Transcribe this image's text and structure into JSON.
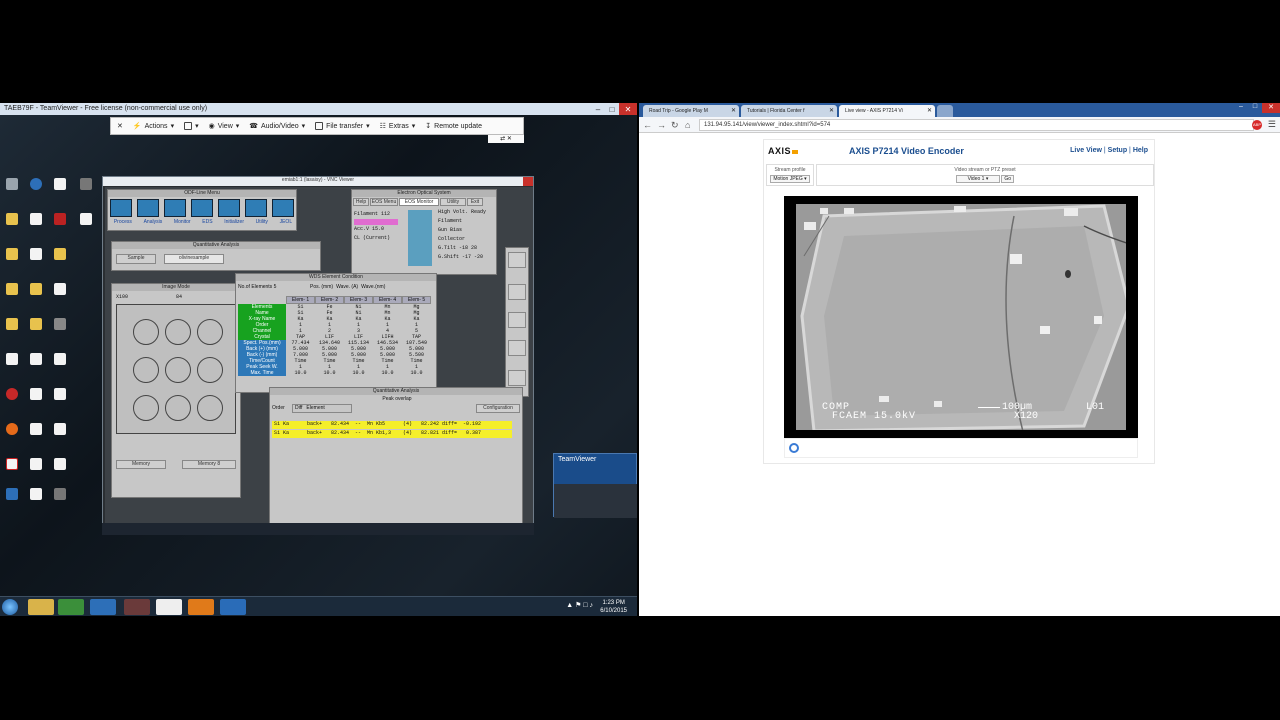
{
  "left": {
    "teamviewer_title": "TAEB79F - TeamViewer - Free license (non-commercial use only)",
    "toolbar": {
      "actions": "Actions",
      "view": "View",
      "audio_video": "Audio/Video",
      "file_transfer": "File transfer",
      "extras": "Extras",
      "remote_update": "Remote update"
    },
    "vnc_title": "emiab1:1 (lasaisy) - VNC Viewer",
    "odf_menu_title": "ODF-Line Menu",
    "odf_buttons": [
      "Process",
      "Analysis",
      "Monitor",
      "EDS",
      "Initializer",
      "Utility",
      "JEOL"
    ],
    "eos_title": "Electron Optical System",
    "eos_menu": [
      "Help",
      "EOS Menu",
      "EOS Monitor",
      "Utility",
      "Exit"
    ],
    "eos_left": [
      "Filament 112",
      "Acc.V 15.0",
      "CL (Current)"
    ],
    "eos_right": [
      "High Volt. Ready",
      "Filament",
      "Gun Bias",
      "Collector",
      "G.Tilt -18 28",
      "G.Shift -17 -20"
    ],
    "quant_title": "Quantitative Analysis",
    "quant_buttons": [
      "Sample",
      "olivinesample"
    ],
    "wds_title": "WDS Element Condition",
    "elements_label": "No.of Elements 5",
    "wds_radio": [
      "Pos. (mm)",
      "Wave. (A)",
      "Wave.(nm)"
    ],
    "wds_cols": [
      "Elem- 1",
      "Elem- 2",
      "Elem- 3",
      "Elem- 4",
      "Elem- 5"
    ],
    "wds_rows": [
      {
        "label": "Elements",
        "vals": [
          "Si",
          "Fe",
          "Ni",
          "Mn",
          "Mg"
        ]
      },
      {
        "label": "Name",
        "vals": [
          "Si",
          "Fe",
          "Ni",
          "Mn",
          "Mg"
        ]
      },
      {
        "label": "X-ray Name",
        "vals": [
          "Ka",
          "Ka",
          "Ka",
          "Ka",
          "Ka"
        ]
      },
      {
        "label": "Order",
        "vals": [
          "1",
          "1",
          "1",
          "1",
          "1"
        ]
      },
      {
        "label": "Channel",
        "vals": [
          "1",
          "2",
          "3",
          "4",
          "5"
        ]
      },
      {
        "label": "Crystal",
        "vals": [
          "TAP",
          "LIF",
          "LIF",
          "LIFH",
          "TAP"
        ]
      },
      {
        "label": "Spect. Pos.(mm)",
        "vals": [
          "77.434",
          "134.640",
          "115.134",
          "146.534",
          "107.549"
        ]
      },
      {
        "label": "Back (+) (mm)",
        "vals": [
          "5.000",
          "5.000",
          "5.000",
          "5.000",
          "5.000"
        ]
      },
      {
        "label": "Back (-) (mm)",
        "vals": [
          "7.000",
          "5.000",
          "5.000",
          "5.000",
          "5.500"
        ]
      },
      {
        "label": "Time/Count",
        "vals": [
          "Time",
          "Time",
          "Time",
          "Time",
          "Time"
        ]
      },
      {
        "label": "Peak Seek W.",
        "vals": [
          "1",
          "1",
          "1",
          "1",
          "1"
        ]
      },
      {
        "label": "Max. Time",
        "vals": [
          "10.0",
          "10.0",
          "10.0",
          "10.0",
          "10.0"
        ]
      }
    ],
    "image_title": "Image Mode",
    "image_labels": [
      "X100",
      "84"
    ],
    "image_side_btns": [
      "Memory",
      "Memory 8"
    ],
    "peak_title": "Quantitative Analysis",
    "peak_subtitle": "Peak overlap",
    "peak_order_label": "Order",
    "peak_radio": [
      "Diff",
      "Element"
    ],
    "peak_config": "Configuration",
    "peak_rows": [
      "Si Ka      back+   82.434  --  Mn Kb5      (4)   82.242 diff=  -0.192",
      "Si Ka      back+   82.434  --  Mn Kb1,3    (4)   82.821 diff=   0.387"
    ],
    "teamviewer_popup": "TeamViewer",
    "clock_time": "1:23 PM",
    "clock_date": "6/10/2015"
  },
  "right": {
    "tabs": [
      "Road Trip - Google Play M",
      "Tutorials | Florida Center f",
      "Live view - AXIS P7214 Vi"
    ],
    "url": "131.94.95.141/view/viewer_index.shtml?id=574",
    "axis_logo": "AXIS",
    "page_title": "AXIS P7214 Video Encoder",
    "nav": {
      "live_view": "Live View",
      "setup": "Setup",
      "help": "Help"
    },
    "stream_profile_label": "Stream profile",
    "stream_profile_value": "Motion JPEG",
    "stream_preset_label": "Video stream or PTZ preset",
    "stream_preset_value": "Video 1",
    "go_button": "Go",
    "video_overlay": {
      "left": "COMP",
      "detector": "FCAEM 15.0kV",
      "scale": "100µm",
      "mag": "X120",
      "id": "L01"
    }
  }
}
